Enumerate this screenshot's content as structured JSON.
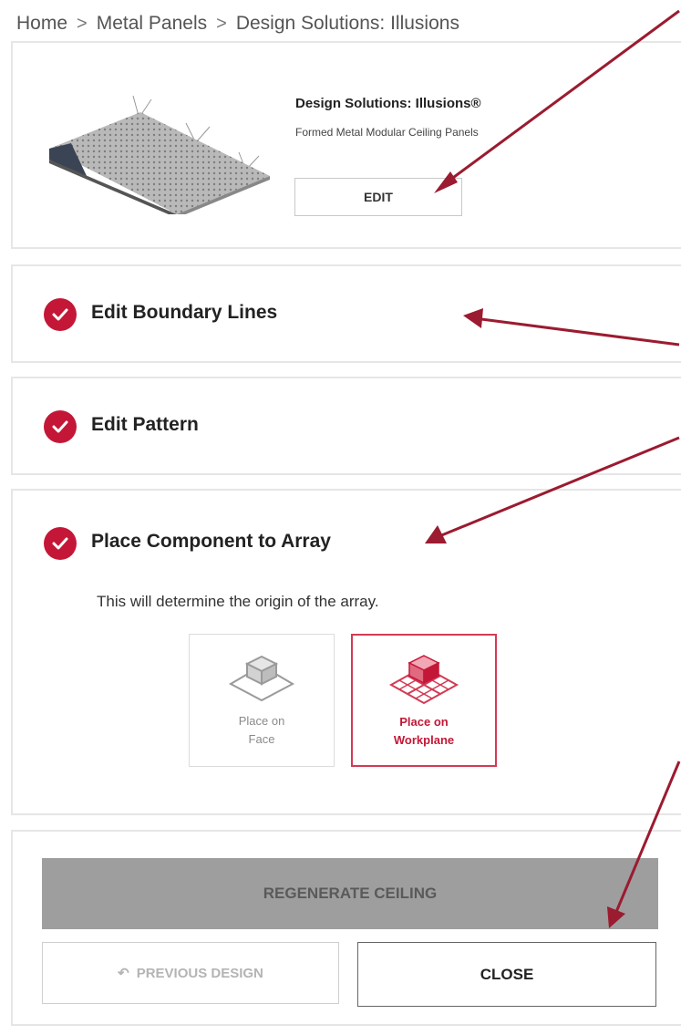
{
  "breadcrumb": {
    "items": [
      "Home",
      "Metal Panels",
      "Design Solutions: Illusions"
    ],
    "separator": ">"
  },
  "product": {
    "title": "Design Solutions: Illusions®",
    "subtitle": "Formed Metal Modular Ceiling Panels",
    "edit_label": "EDIT"
  },
  "steps": [
    {
      "title": "Edit Boundary Lines",
      "status_icon": "check-circle-icon"
    },
    {
      "title": "Edit Pattern",
      "status_icon": "check-circle-icon"
    },
    {
      "title": "Place Component to Array",
      "status_icon": "check-circle-icon",
      "description": "This will determine the origin of the array."
    }
  ],
  "placement_options": [
    {
      "line1": "Place on",
      "line2": "Face",
      "icon": "place-on-face-icon",
      "selected": false
    },
    {
      "line1": "Place on",
      "line2": "Workplane",
      "icon": "place-on-workplane-icon",
      "selected": true
    }
  ],
  "actions": {
    "regenerate_label": "REGENERATE CEILING",
    "previous_label": "PREVIOUS DESIGN",
    "close_label": "CLOSE"
  },
  "colors": {
    "accent": "#c41737",
    "arrow": "#9b1b30",
    "disabled_button": "#9e9e9e"
  }
}
